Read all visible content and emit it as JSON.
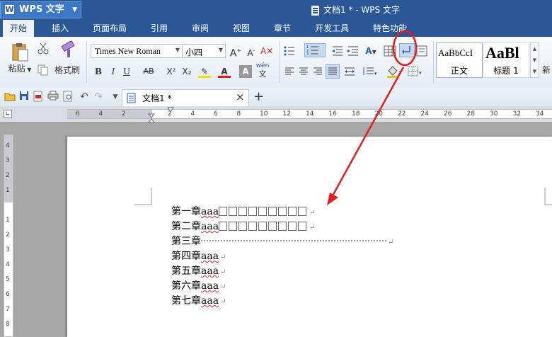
{
  "app": {
    "menu_button": "WPS 文字",
    "window_title": "文档1 * - WPS 文字"
  },
  "menu": {
    "items": [
      "开始",
      "插入",
      "页面布局",
      "引用",
      "审阅",
      "视图",
      "章节",
      "开发工具",
      "特色功能"
    ],
    "active": "开始"
  },
  "ribbon": {
    "paste_label": "粘贴",
    "format_painter_label": "格式刷",
    "font_name": "Times New Roman",
    "font_size": "小四",
    "bold": "B",
    "italic": "I",
    "underline": "U",
    "strike": "AB",
    "superscript": "X²",
    "subscript": "X₂",
    "pinyin": "wén",
    "style_normal_preview": "AaBbCcI",
    "style_normal_label": "正文",
    "style_h1_preview": "AaBl",
    "style_h1_label": "标题 1",
    "new_style_label": "新",
    "annotation_color": "#e02020"
  },
  "tabs": {
    "doc_tab": "文档1 *",
    "close_glyph": "×",
    "add_glyph": "+"
  },
  "ruler": {
    "h_labels": [
      "6",
      "4",
      "2",
      "",
      "2",
      "4",
      "6",
      "8",
      "10",
      "12",
      "14",
      "16",
      "18",
      "20",
      "22",
      "24",
      "26",
      "28",
      "30",
      "32",
      "34"
    ],
    "v_labels": [
      "4",
      "3",
      "2",
      "1",
      "",
      "1",
      "2",
      "3",
      "4",
      "5",
      "6",
      "7",
      "8"
    ]
  },
  "document": {
    "lines": [
      {
        "prefix": "第一章",
        "suffix": "aaa",
        "filler": "boxes"
      },
      {
        "prefix": "第二章",
        "suffix": "aaa",
        "filler": "boxes"
      },
      {
        "prefix": "第三章",
        "suffix": "",
        "filler": "dots"
      },
      {
        "prefix": "第四章",
        "suffix": "aaa",
        "filler": "none"
      },
      {
        "prefix": "第五章",
        "suffix": "aaa",
        "filler": "none"
      },
      {
        "prefix": "第六章",
        "suffix": "aaa",
        "filler": "none"
      },
      {
        "prefix": "第七章",
        "suffix": "aaa",
        "filler": "none"
      }
    ],
    "return_mark": "↵"
  }
}
